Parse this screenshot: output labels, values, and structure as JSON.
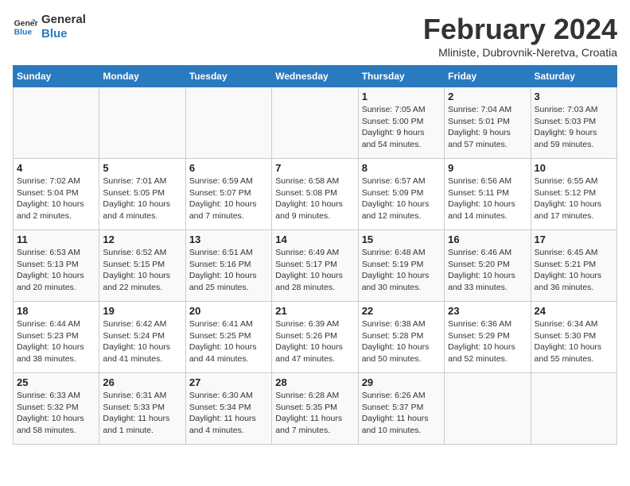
{
  "header": {
    "logo_line1": "General",
    "logo_line2": "Blue",
    "month_title": "February 2024",
    "location": "Mliniste, Dubrovnik-Neretva, Croatia"
  },
  "weekdays": [
    "Sunday",
    "Monday",
    "Tuesday",
    "Wednesday",
    "Thursday",
    "Friday",
    "Saturday"
  ],
  "weeks": [
    [
      {
        "day": "",
        "info": ""
      },
      {
        "day": "",
        "info": ""
      },
      {
        "day": "",
        "info": ""
      },
      {
        "day": "",
        "info": ""
      },
      {
        "day": "1",
        "info": "Sunrise: 7:05 AM\nSunset: 5:00 PM\nDaylight: 9 hours\nand 54 minutes."
      },
      {
        "day": "2",
        "info": "Sunrise: 7:04 AM\nSunset: 5:01 PM\nDaylight: 9 hours\nand 57 minutes."
      },
      {
        "day": "3",
        "info": "Sunrise: 7:03 AM\nSunset: 5:03 PM\nDaylight: 9 hours\nand 59 minutes."
      }
    ],
    [
      {
        "day": "4",
        "info": "Sunrise: 7:02 AM\nSunset: 5:04 PM\nDaylight: 10 hours\nand 2 minutes."
      },
      {
        "day": "5",
        "info": "Sunrise: 7:01 AM\nSunset: 5:05 PM\nDaylight: 10 hours\nand 4 minutes."
      },
      {
        "day": "6",
        "info": "Sunrise: 6:59 AM\nSunset: 5:07 PM\nDaylight: 10 hours\nand 7 minutes."
      },
      {
        "day": "7",
        "info": "Sunrise: 6:58 AM\nSunset: 5:08 PM\nDaylight: 10 hours\nand 9 minutes."
      },
      {
        "day": "8",
        "info": "Sunrise: 6:57 AM\nSunset: 5:09 PM\nDaylight: 10 hours\nand 12 minutes."
      },
      {
        "day": "9",
        "info": "Sunrise: 6:56 AM\nSunset: 5:11 PM\nDaylight: 10 hours\nand 14 minutes."
      },
      {
        "day": "10",
        "info": "Sunrise: 6:55 AM\nSunset: 5:12 PM\nDaylight: 10 hours\nand 17 minutes."
      }
    ],
    [
      {
        "day": "11",
        "info": "Sunrise: 6:53 AM\nSunset: 5:13 PM\nDaylight: 10 hours\nand 20 minutes."
      },
      {
        "day": "12",
        "info": "Sunrise: 6:52 AM\nSunset: 5:15 PM\nDaylight: 10 hours\nand 22 minutes."
      },
      {
        "day": "13",
        "info": "Sunrise: 6:51 AM\nSunset: 5:16 PM\nDaylight: 10 hours\nand 25 minutes."
      },
      {
        "day": "14",
        "info": "Sunrise: 6:49 AM\nSunset: 5:17 PM\nDaylight: 10 hours\nand 28 minutes."
      },
      {
        "day": "15",
        "info": "Sunrise: 6:48 AM\nSunset: 5:19 PM\nDaylight: 10 hours\nand 30 minutes."
      },
      {
        "day": "16",
        "info": "Sunrise: 6:46 AM\nSunset: 5:20 PM\nDaylight: 10 hours\nand 33 minutes."
      },
      {
        "day": "17",
        "info": "Sunrise: 6:45 AM\nSunset: 5:21 PM\nDaylight: 10 hours\nand 36 minutes."
      }
    ],
    [
      {
        "day": "18",
        "info": "Sunrise: 6:44 AM\nSunset: 5:23 PM\nDaylight: 10 hours\nand 38 minutes."
      },
      {
        "day": "19",
        "info": "Sunrise: 6:42 AM\nSunset: 5:24 PM\nDaylight: 10 hours\nand 41 minutes."
      },
      {
        "day": "20",
        "info": "Sunrise: 6:41 AM\nSunset: 5:25 PM\nDaylight: 10 hours\nand 44 minutes."
      },
      {
        "day": "21",
        "info": "Sunrise: 6:39 AM\nSunset: 5:26 PM\nDaylight: 10 hours\nand 47 minutes."
      },
      {
        "day": "22",
        "info": "Sunrise: 6:38 AM\nSunset: 5:28 PM\nDaylight: 10 hours\nand 50 minutes."
      },
      {
        "day": "23",
        "info": "Sunrise: 6:36 AM\nSunset: 5:29 PM\nDaylight: 10 hours\nand 52 minutes."
      },
      {
        "day": "24",
        "info": "Sunrise: 6:34 AM\nSunset: 5:30 PM\nDaylight: 10 hours\nand 55 minutes."
      }
    ],
    [
      {
        "day": "25",
        "info": "Sunrise: 6:33 AM\nSunset: 5:32 PM\nDaylight: 10 hours\nand 58 minutes."
      },
      {
        "day": "26",
        "info": "Sunrise: 6:31 AM\nSunset: 5:33 PM\nDaylight: 11 hours\nand 1 minute."
      },
      {
        "day": "27",
        "info": "Sunrise: 6:30 AM\nSunset: 5:34 PM\nDaylight: 11 hours\nand 4 minutes."
      },
      {
        "day": "28",
        "info": "Sunrise: 6:28 AM\nSunset: 5:35 PM\nDaylight: 11 hours\nand 7 minutes."
      },
      {
        "day": "29",
        "info": "Sunrise: 6:26 AM\nSunset: 5:37 PM\nDaylight: 11 hours\nand 10 minutes."
      },
      {
        "day": "",
        "info": ""
      },
      {
        "day": "",
        "info": ""
      }
    ]
  ]
}
